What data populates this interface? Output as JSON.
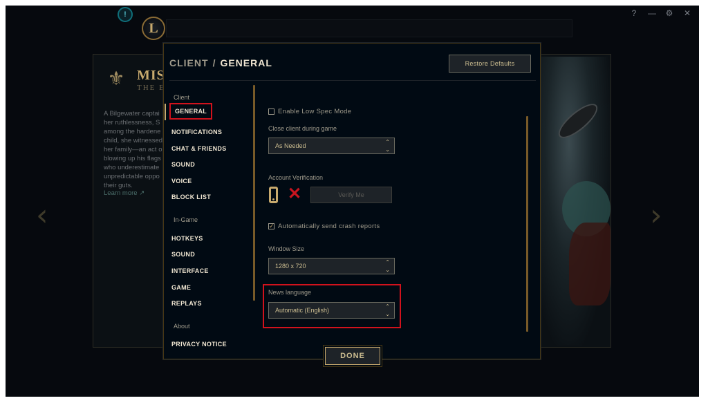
{
  "window": {
    "help_icon": "?",
    "minimize_icon": "—",
    "settings_icon": "⚙",
    "close_icon": "✕",
    "badge_text": "!",
    "logo_text": "L"
  },
  "background": {
    "heading": "MIS",
    "subheading": "THE B",
    "text_lines": [
      "A Bilgewater captai",
      "her ruthlessness, S",
      "among the hardene",
      "child, she witnessed",
      "her family—an act o",
      "blowing up his flags",
      "who underestimate",
      "unpredictable oppo",
      "their guts."
    ],
    "learn_more": "Learn more ↗"
  },
  "dialog": {
    "breadcrumb_parent": "CLIENT",
    "breadcrumb_separator": "/",
    "breadcrumb_current": "GENERAL",
    "restore_defaults": "Restore Defaults",
    "done": "DONE"
  },
  "sidebar": {
    "client_section": "Client",
    "client_items": [
      "GENERAL",
      "NOTIFICATIONS",
      "CHAT & FRIENDS",
      "SOUND",
      "VOICE",
      "BLOCK LIST"
    ],
    "ingame_section": "In-Game",
    "ingame_items": [
      "HOTKEYS",
      "SOUND",
      "INTERFACE",
      "GAME",
      "REPLAYS"
    ],
    "about_section": "About",
    "about_items": [
      "PRIVACY NOTICE"
    ]
  },
  "settings": {
    "low_spec": {
      "label": "Enable Low Spec Mode",
      "checked": false
    },
    "close_client": {
      "label": "Close client during game",
      "value": "As Needed"
    },
    "account_verification": {
      "label": "Account Verification",
      "verify_button": "Verify Me"
    },
    "crash_reports": {
      "label": "Automatically send crash reports",
      "checked": true
    },
    "window_size": {
      "label": "Window Size",
      "value": "1280 x 720"
    },
    "news_language": {
      "label": "News language",
      "value": "Automatic (English)"
    }
  },
  "colors": {
    "gold": "#c8aa6e",
    "highlight_red": "#d1121c",
    "dialog_bg": "#010a13"
  }
}
